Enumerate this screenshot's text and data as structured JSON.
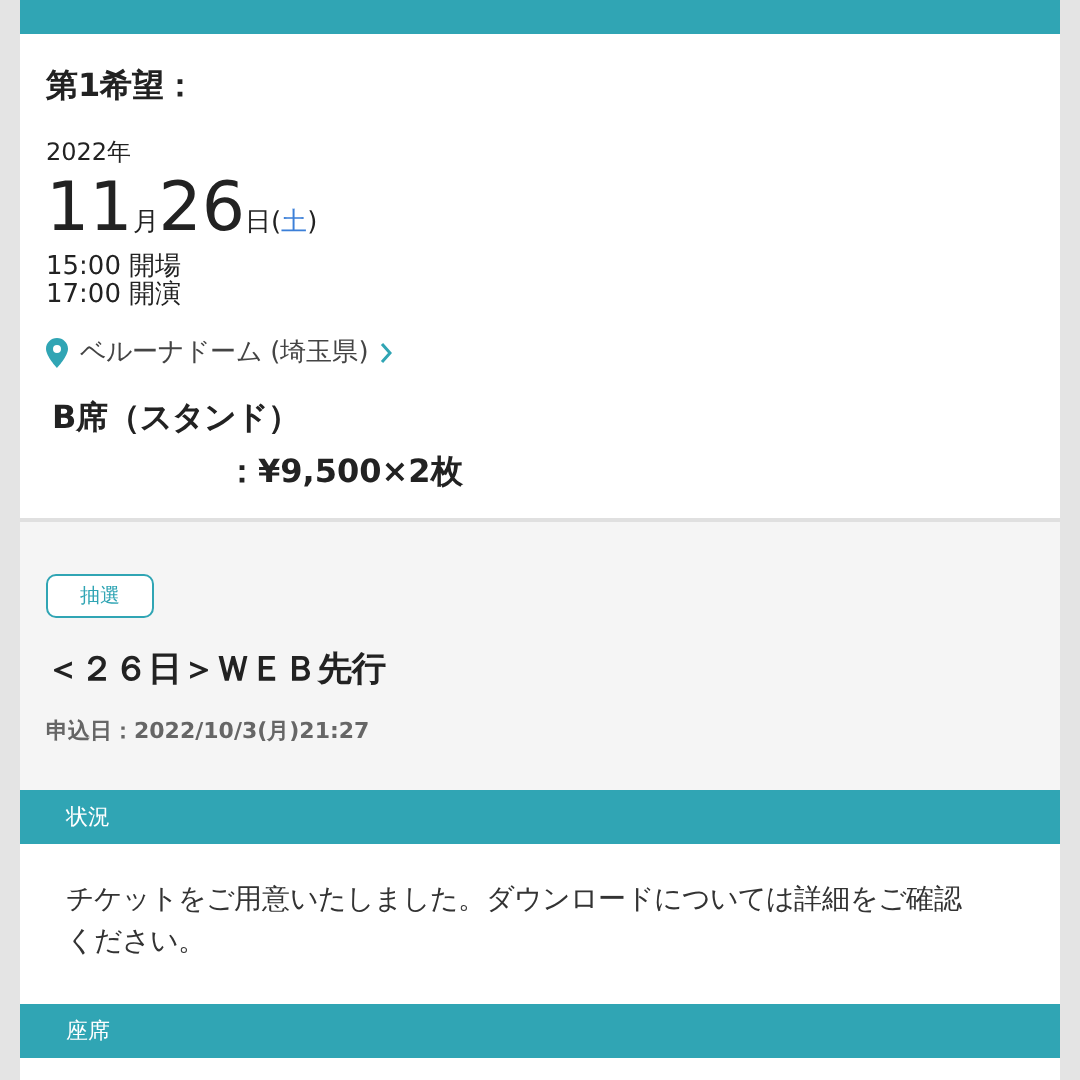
{
  "preference": {
    "label": "第1希望：",
    "year": "2022年",
    "month": "11",
    "month_unit": "月",
    "day": "26",
    "day_unit": "日",
    "weekday": {
      "open": "(",
      "day": "土",
      "close": ")",
      "color": "#3b7fd8"
    },
    "times": [
      "15:00 開場",
      "17:00 開演"
    ],
    "venue": "ベルーナドーム (埼玉県)",
    "seat": "B席（スタンド）",
    "price": "：¥9,500×2枚"
  },
  "entry": {
    "badge": "抽選",
    "title": "＜２６日＞ＷＥＢ先行",
    "applied": "申込日：2022/10/3(月)21:27"
  },
  "sections": [
    {
      "header": "状況",
      "body": "チケットをご用意いたしました。ダウンロードについては詳細をご確認ください。"
    },
    {
      "header": "座席"
    }
  ]
}
